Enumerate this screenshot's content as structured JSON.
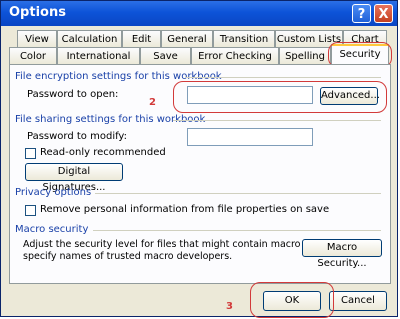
{
  "window": {
    "title": "Options",
    "help_btn": "?",
    "close_btn": "X"
  },
  "tabs": {
    "row1": [
      "View",
      "Calculation",
      "Edit",
      "General",
      "Transition",
      "Custom Lists",
      "Chart"
    ],
    "row2": [
      "Color",
      "International",
      "Save",
      "Error Checking",
      "Spelling",
      "Security"
    ],
    "active": "Security"
  },
  "sections": {
    "file_encryption": "File encryption settings for this workbook",
    "file_sharing": "File sharing settings for this workbook",
    "privacy": "Privacy options",
    "macro": "Macro security"
  },
  "labels": {
    "password_open": "Password to open:",
    "password_modify": "Password to modify:",
    "read_only": "Read-only recommended",
    "remove_personal": "Remove personal information from file properties on save",
    "macro_desc_1": "Adjust the security level for files that might contain macro viruses and",
    "macro_desc_2": "specify names of trusted macro developers."
  },
  "buttons": {
    "advanced": "Advanced...",
    "digital_signatures": "Digital Signatures...",
    "macro_security": "Macro Security...",
    "ok": "OK",
    "cancel": "Cancel"
  },
  "inputs": {
    "password_open_value": "",
    "password_modify_value": ""
  },
  "annotations": {
    "step2": "2",
    "step3": "3"
  }
}
